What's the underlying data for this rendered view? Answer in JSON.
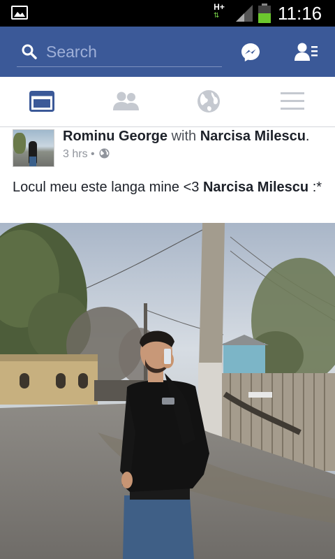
{
  "status_bar": {
    "network_type": "H+",
    "time": "11:16"
  },
  "header": {
    "search_placeholder": "Search"
  },
  "tabs": [
    {
      "name": "news-feed",
      "active": true
    },
    {
      "name": "friends",
      "active": false
    },
    {
      "name": "notifications",
      "active": false
    },
    {
      "name": "menu",
      "active": false
    }
  ],
  "post": {
    "author": "Rominu George",
    "with_word": "with",
    "tagged": "Narcisa Milescu",
    "tagged_suffix": ".",
    "time": "3 hrs",
    "separator": "•",
    "text_prefix": "Locul meu este langa mine <3 ",
    "text_tag": "Narcisa Milescu",
    "text_suffix": " :*"
  },
  "colors": {
    "fb_blue": "#3b5998",
    "status_bar": "#000000"
  }
}
